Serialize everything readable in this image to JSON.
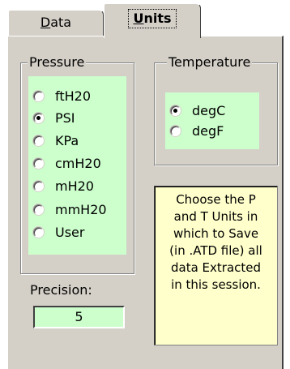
{
  "tabs": [
    {
      "label": "Data",
      "selected": false
    },
    {
      "label": "Units",
      "selected": true
    }
  ],
  "pressure": {
    "legend": "Pressure",
    "options": [
      {
        "label": "ftH20",
        "checked": false
      },
      {
        "label": "PSI",
        "checked": true
      },
      {
        "label": "KPa",
        "checked": false
      },
      {
        "label": "cmH20",
        "checked": false
      },
      {
        "label": "mH20",
        "checked": false
      },
      {
        "label": "mmH20",
        "checked": false
      },
      {
        "label": "User",
        "checked": false
      }
    ],
    "precision_label": "Precision:",
    "precision_value": "5"
  },
  "temperature": {
    "legend": "Temperature",
    "options": [
      {
        "label": "degC",
        "checked": true
      },
      {
        "label": "degF",
        "checked": false
      }
    ]
  },
  "note": {
    "lines": [
      "Choose the P",
      "and T Units in",
      "which to Save",
      "(in .ATD file) all",
      "data Extracted",
      "in this session."
    ]
  },
  "colors": {
    "face": "#d4d0c8",
    "green": "#ccffcc",
    "note_bg": "#ffffcc"
  }
}
